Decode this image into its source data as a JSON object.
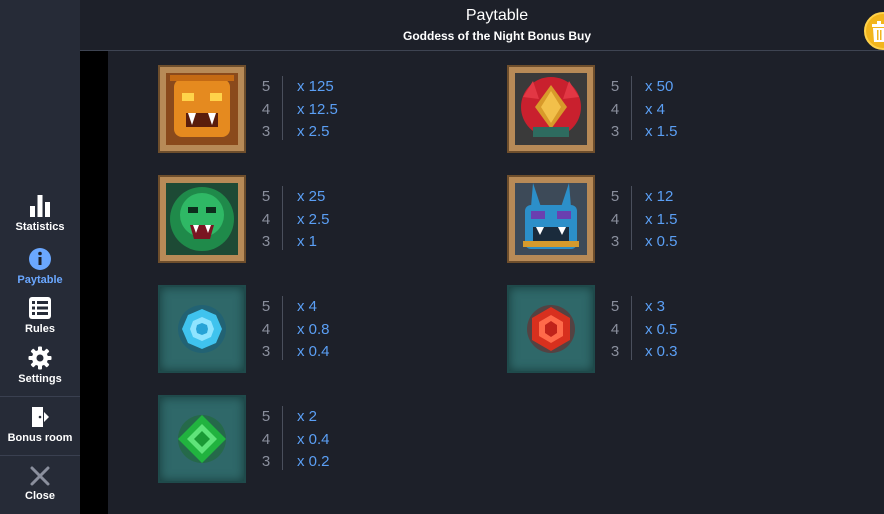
{
  "header": {
    "title": "Paytable",
    "subtitle": "Goddess of the Night Bonus Buy"
  },
  "sidebar": {
    "items": [
      {
        "label": "Statistics",
        "icon": "bar-chart-icon"
      },
      {
        "label": "Paytable",
        "icon": "info-icon",
        "active": true
      },
      {
        "label": "Rules",
        "icon": "list-icon"
      },
      {
        "label": "Settings",
        "icon": "gear-icon"
      },
      {
        "label": "Bonus room",
        "icon": "door-icon"
      },
      {
        "label": "Close",
        "icon": "close-icon"
      }
    ]
  },
  "paytable": {
    "counts": [
      "5",
      "4",
      "3"
    ],
    "symbols": [
      {
        "symbol": "orange-mask",
        "values": [
          "x 125",
          "x 12.5",
          "x 2.5"
        ]
      },
      {
        "symbol": "red-feathered-mask",
        "values": [
          "x 50",
          "x 4",
          "x 1.5"
        ]
      },
      {
        "symbol": "green-serpent-mask",
        "values": [
          "x 25",
          "x 2.5",
          "x 1"
        ]
      },
      {
        "symbol": "blue-rabbit-mask",
        "values": [
          "x 12",
          "x 1.5",
          "x 0.5"
        ]
      },
      {
        "symbol": "blue-gem",
        "values": [
          "x 4",
          "x 0.8",
          "x 0.4"
        ]
      },
      {
        "symbol": "red-gem",
        "values": [
          "x 3",
          "x 0.5",
          "x 0.3"
        ]
      },
      {
        "symbol": "green-gem",
        "values": [
          "x 2",
          "x 0.4",
          "x 0.2"
        ]
      }
    ]
  },
  "colors": {
    "background": "#1d2029",
    "sidebar": "#262b37",
    "accent": "#5b9ff5",
    "active_nav": "#6aa7ff",
    "close_button": "#f2b51d"
  }
}
